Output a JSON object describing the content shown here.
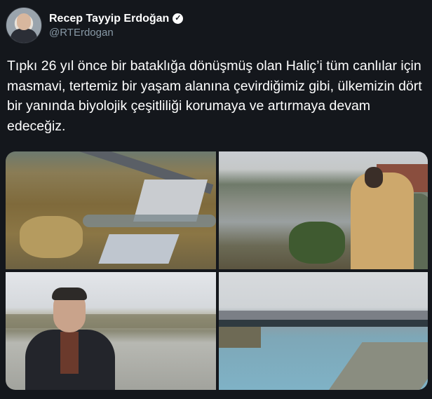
{
  "user": {
    "display_name": "Recep Tayyip Erdoğan",
    "handle": "@RTErdogan",
    "verified": true,
    "verified_glyph": "✓"
  },
  "tweet": {
    "text": "Tıpkı 26 yıl önce bir bataklığa dönüşmüş olan Haliç’i tüm canlılar için masmavi, tertemiz bir yaşam alanına çevirdiğimiz gibi, ülkemizin dört bir yanında biyolojik çeşitliliği korumaya ve artırmaya devam edeceğiz."
  },
  "media": {
    "count": 4,
    "photos": [
      "aerial-marshland-photo",
      "golden-horn-overlook-photo",
      "portrait-by-water-photo",
      "golden-horn-bridge-photo"
    ]
  },
  "colors": {
    "background": "#14171c",
    "text": "#ffffff",
    "handle": "#8899a6"
  }
}
